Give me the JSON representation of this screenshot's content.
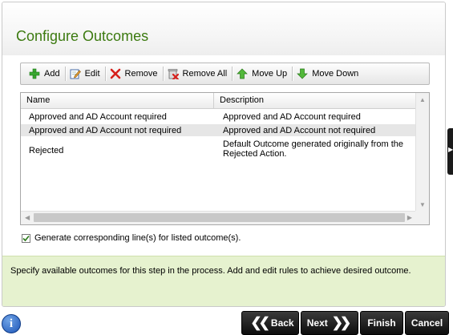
{
  "dialog": {
    "title": "Configure Outcomes"
  },
  "toolbar": {
    "add": "Add",
    "edit": "Edit",
    "remove": "Remove",
    "remove_all": "Remove All",
    "move_up": "Move Up",
    "move_down": "Move Down"
  },
  "grid": {
    "columns": [
      "Name",
      "Description"
    ],
    "rows": [
      {
        "name": "Approved and AD Account required",
        "description": "Approved and AD Account required"
      },
      {
        "name": "Approved and AD Account not required",
        "description": "Approved and AD Account not required"
      },
      {
        "name": "Rejected",
        "description": "Default Outcome generated originally from the Rejected Action."
      }
    ]
  },
  "generate_lines": {
    "label": "Generate corresponding line(s) for listed outcome(s).",
    "checked": true
  },
  "info": {
    "text": "Specify available outcomes for this step in the process.  Add and edit rules to achieve desired outcome."
  },
  "footer": {
    "info_icon": "i",
    "back": "Back",
    "next": "Next",
    "finish": "Finish",
    "cancel": "Cancel"
  },
  "colors": {
    "title_green": "#3c7a10",
    "info_band": "#e6f2cf",
    "nav_button": "#1a1a1a"
  }
}
